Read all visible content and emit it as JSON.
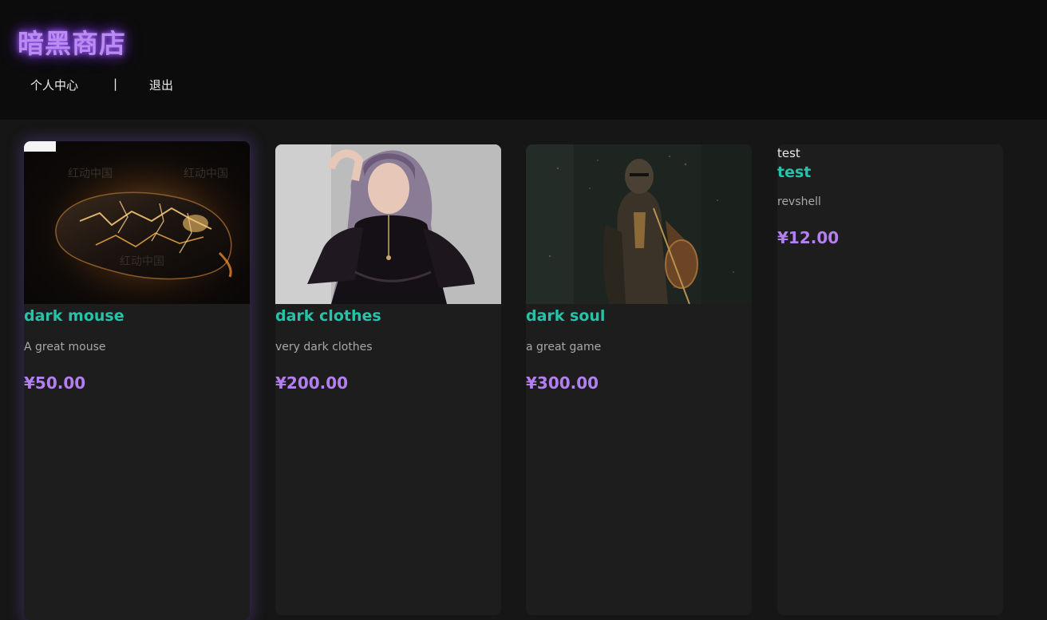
{
  "header": {
    "brand": "暗黑商店",
    "nav": {
      "profile": "个人中心",
      "separator": "|",
      "logout": "退出"
    }
  },
  "products": [
    {
      "title": "dark mouse",
      "description": "A great mouse",
      "price": "¥50.00",
      "image": "mouse-photo"
    },
    {
      "title": "dark clothes",
      "description": "very dark clothes",
      "price": "¥200.00",
      "image": "clothes-photo"
    },
    {
      "title": "dark soul",
      "description": "a great game",
      "price": "¥300.00",
      "image": "knight-photo"
    },
    {
      "broken_image_alt": "test",
      "title": "test",
      "description": "revshell",
      "price": "¥12.00"
    }
  ],
  "colors": {
    "header_bg": "#0c0c0c",
    "page_bg": "#161616",
    "card_bg": "#1d1d1d",
    "title": "#27c2a8",
    "price": "#b47ff0",
    "brand": "#b98df0"
  }
}
